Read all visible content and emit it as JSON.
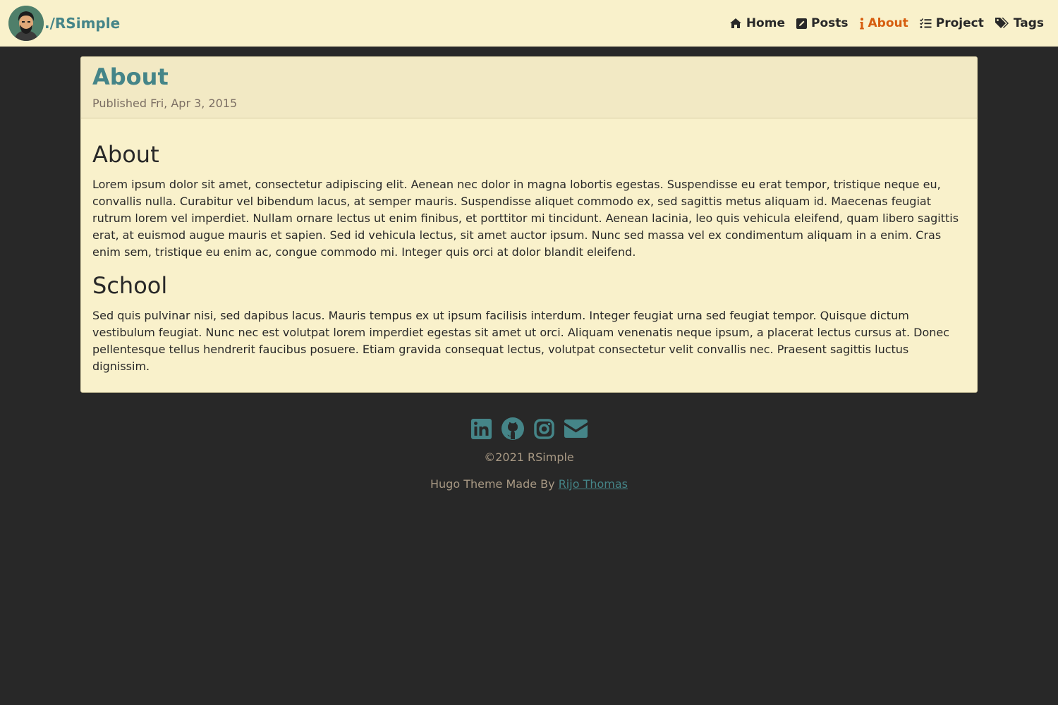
{
  "site": {
    "brand": "./RSimple"
  },
  "nav": {
    "items": [
      {
        "label": "Home",
        "icon": "home-icon"
      },
      {
        "label": "Posts",
        "icon": "edit-icon"
      },
      {
        "label": "About",
        "icon": "info-icon",
        "active": true
      },
      {
        "label": "Project",
        "icon": "tasks-icon"
      },
      {
        "label": "Tags",
        "icon": "tags-icon"
      }
    ]
  },
  "post": {
    "title": "About",
    "published": "Published Fri, Apr 3, 2015",
    "sections": [
      {
        "heading": "About",
        "body": "Lorem ipsum dolor sit amet, consectetur adipiscing elit. Aenean nec dolor in magna lobortis egestas. Suspendisse eu erat tempor, tristique neque eu, convallis nulla. Curabitur vel bibendum lacus, at semper mauris. Suspendisse aliquet commodo ex, sed sagittis metus aliquam id. Maecenas feugiat rutrum lorem vel imperdiet. Nullam ornare lectus ut enim finibus, et porttitor mi tincidunt. Aenean lacinia, leo quis vehicula eleifend, quam libero sagittis erat, at euismod augue mauris et sapien. Sed id vehicula lectus, sit amet auctor ipsum. Nunc sed massa vel ex condimentum aliquam in a enim. Cras enim sem, tristique eu enim ac, congue commodo mi. Integer quis orci at dolor blandit eleifend."
      },
      {
        "heading": "School",
        "body": "Sed quis pulvinar nisi, sed dapibus lacus. Mauris tempus ex ut ipsum facilisis interdum. Integer feugiat urna sed feugiat tempor. Quisque dictum vestibulum feugiat. Nunc nec est volutpat lorem imperdiet egestas sit amet ut orci. Aliquam venenatis neque ipsum, a placerat lectus cursus at. Donec pellentesque tellus hendrerit faucibus posuere. Etiam gravida consequat lectus, volutpat consectetur velit convallis nec. Praesent sagittis luctus dignissim."
      }
    ]
  },
  "footer": {
    "social": [
      "linkedin-icon",
      "github-icon",
      "instagram-icon",
      "envelope-icon"
    ],
    "copyright": "©2021 RSimple",
    "credit_prefix": "Hugo Theme Made By ",
    "credit_link": "Rijo Thomas"
  },
  "colors": {
    "background": "#282828",
    "surface": "#f9f1cb",
    "accent": "#458588",
    "active": "#d65d0e",
    "muted": "#a89984"
  }
}
